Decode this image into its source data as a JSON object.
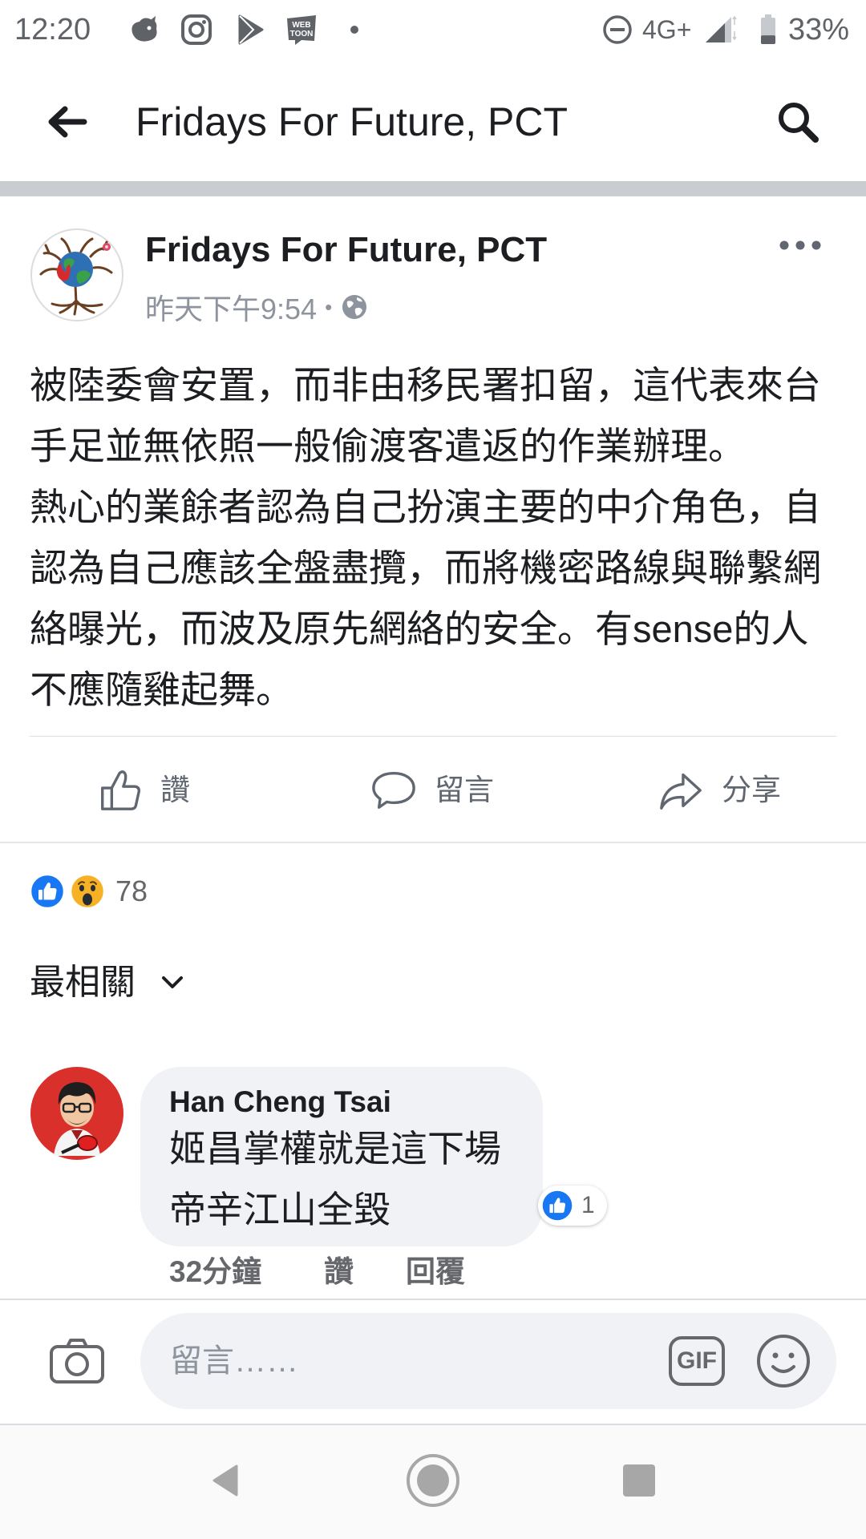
{
  "status_bar": {
    "time": "12:20",
    "notification_icons": [
      "creature-app-icon",
      "instagram-icon",
      "play-store-icon",
      "webtoon-icon",
      "more-notifications-dot-icon"
    ],
    "webtoon_logo_lines": [
      "WEB",
      "TOON"
    ],
    "status_icons": [
      "do-not-disturb-icon",
      "signal-icon",
      "battery-icon"
    ],
    "network": "4G+",
    "battery": "33%",
    "battery_level": 0.33
  },
  "app_bar": {
    "back_icon": "back-arrow-icon",
    "title": "Fridays For Future, PCT",
    "search_icon": "search-icon"
  },
  "post": {
    "author": "Fridays For Future, PCT",
    "timestamp": "昨天下午9:54",
    "separator": "•",
    "privacy_icon": "globe-icon",
    "more_icon": "more-options-icon",
    "body_lines": [
      "被陸委會安置，而非由移民署扣留，這代表來台",
      "手足並無依照一般偷渡客遣返的作業辦理。",
      "熱心的業餘者認為自己扮演主要的中介角色，自",
      "認為自己應該全盤盡攬，而將機密路線與聯繫網",
      "絡曝光，而波及原先網絡的安全。有sense的人",
      "不應隨雞起舞。"
    ],
    "actions": [
      {
        "icon": "like-icon",
        "label": "讚"
      },
      {
        "icon": "comment-icon",
        "label": "留言"
      },
      {
        "icon": "share-icon",
        "label": "分享"
      }
    ],
    "reactions": [
      "like-reaction-icon",
      "wow-reaction-icon"
    ],
    "reaction_count": "78"
  },
  "comments_filter": {
    "label": "最相關",
    "icon": "chevron-down-icon"
  },
  "comments": [
    {
      "author": "Han Cheng Tsai",
      "lines": [
        "姬昌掌權就是這下場",
        "帝辛江山全毀"
      ],
      "reaction_icon": "like-reaction-icon",
      "reaction_count": "1",
      "time": "32分鐘",
      "like_label": "讚",
      "reply_label": "回覆"
    }
  ],
  "composer": {
    "camera_icon": "camera-icon",
    "placeholder": "留言……",
    "gif_label": "GIF",
    "emoji_icon": "emoji-icon"
  },
  "nav_bar": {
    "icons": [
      "nav-back-icon",
      "nav-home-icon",
      "nav-recents-icon"
    ]
  },
  "colors": {
    "accent": "#1877f2",
    "text": "#1c1e21",
    "secondary_text": "#65676b",
    "bubble": "#f0f2f5",
    "separator": "#c9ccd1",
    "wow": "#f7b125"
  }
}
